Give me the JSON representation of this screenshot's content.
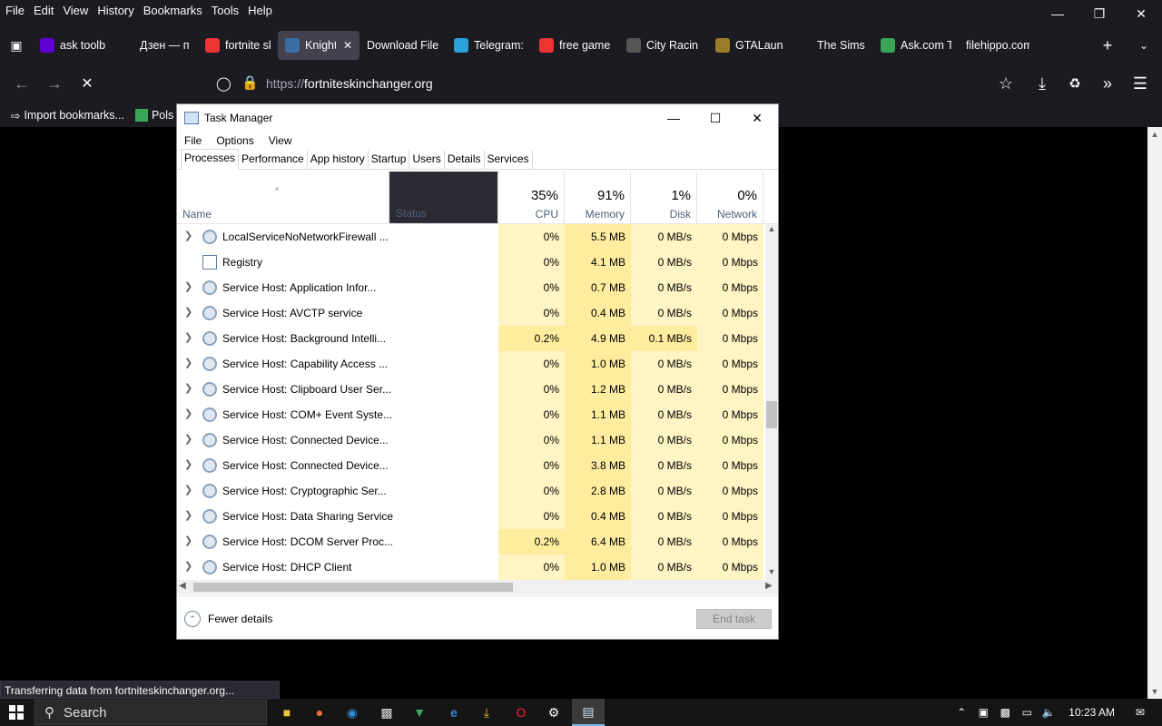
{
  "firefox": {
    "menu": [
      "File",
      "Edit",
      "View",
      "History",
      "Bookmarks",
      "Tools",
      "Help"
    ],
    "tabs": [
      {
        "label": "ask toolba",
        "icon": "yahoo-icon",
        "color": "#6001d2"
      },
      {
        "label": "Дзен — п",
        "icon": "sparkle-icon",
        "color": "#1c1b22"
      },
      {
        "label": "fortnite sk",
        "icon": "yandex-icon",
        "color": "#e33"
      },
      {
        "label": "Knight",
        "icon": "loading-dot-icon",
        "color": "#3a6ea5",
        "active": true
      },
      {
        "label": "Download File",
        "icon": "",
        "color": ""
      },
      {
        "label": "Telegram:",
        "icon": "telegram-icon",
        "color": "#2aa1da"
      },
      {
        "label": "free game",
        "icon": "yandex-icon",
        "color": "#e33"
      },
      {
        "label": "City Racin",
        "icon": "game-icon",
        "color": "#555"
      },
      {
        "label": "GTALaunc",
        "icon": "game-icon",
        "color": "#9a7b2a"
      },
      {
        "label": "The Sims",
        "icon": "plumbob-icon",
        "color": "#1c1b22"
      },
      {
        "label": "Ask.com T",
        "icon": "ask-icon",
        "color": "#3aa655"
      },
      {
        "label": "filehippo.com",
        "icon": "",
        "color": ""
      }
    ],
    "url_proto": "https://",
    "url_host": "fortniteskinchanger.org",
    "bookmarks": [
      {
        "label": "Import bookmarks..."
      },
      {
        "label": "Pols"
      }
    ],
    "status": "Transferring data from fortniteskinchanger.org..."
  },
  "taskmgr": {
    "title": "Task Manager",
    "menu": [
      "File",
      "Options",
      "View"
    ],
    "tabs": [
      "Processes",
      "Performance",
      "App history",
      "Startup",
      "Users",
      "Details",
      "Services"
    ],
    "columns": {
      "name": "Name",
      "status": "Status",
      "cpu_pct": "35%",
      "cpu": "CPU",
      "mem_pct": "91%",
      "mem": "Memory",
      "disk_pct": "1%",
      "disk": "Disk",
      "net_pct": "0%",
      "net": "Network"
    },
    "rows": [
      {
        "name": "LocalServiceNoNetworkFirewall ...",
        "cpu": "0%",
        "mem": "5.5 MB",
        "disk": "0 MB/s",
        "net": "0 Mbps",
        "exp": true
      },
      {
        "name": "Registry",
        "cpu": "0%",
        "mem": "4.1 MB",
        "disk": "0 MB/s",
        "net": "0 Mbps",
        "exp": false
      },
      {
        "name": "Service Host: Application Infor...",
        "cpu": "0%",
        "mem": "0.7 MB",
        "disk": "0 MB/s",
        "net": "0 Mbps",
        "exp": true
      },
      {
        "name": "Service Host: AVCTP service",
        "cpu": "0%",
        "mem": "0.4 MB",
        "disk": "0 MB/s",
        "net": "0 Mbps",
        "exp": true
      },
      {
        "name": "Service Host: Background Intelli...",
        "cpu": "0.2%",
        "mem": "4.9 MB",
        "disk": "0.1 MB/s",
        "net": "0 Mbps",
        "exp": true
      },
      {
        "name": "Service Host: Capability Access ...",
        "cpu": "0%",
        "mem": "1.0 MB",
        "disk": "0 MB/s",
        "net": "0 Mbps",
        "exp": true
      },
      {
        "name": "Service Host: Clipboard User Ser...",
        "cpu": "0%",
        "mem": "1.2 MB",
        "disk": "0 MB/s",
        "net": "0 Mbps",
        "exp": true
      },
      {
        "name": "Service Host: COM+ Event Syste...",
        "cpu": "0%",
        "mem": "1.1 MB",
        "disk": "0 MB/s",
        "net": "0 Mbps",
        "exp": true
      },
      {
        "name": "Service Host: Connected Device...",
        "cpu": "0%",
        "mem": "1.1 MB",
        "disk": "0 MB/s",
        "net": "0 Mbps",
        "exp": true
      },
      {
        "name": "Service Host: Connected Device...",
        "cpu": "0%",
        "mem": "3.8 MB",
        "disk": "0 MB/s",
        "net": "0 Mbps",
        "exp": true
      },
      {
        "name": "Service Host: Cryptographic Ser...",
        "cpu": "0%",
        "mem": "2.8 MB",
        "disk": "0 MB/s",
        "net": "0 Mbps",
        "exp": true
      },
      {
        "name": "Service Host: Data Sharing Service",
        "cpu": "0%",
        "mem": "0.4 MB",
        "disk": "0 MB/s",
        "net": "0 Mbps",
        "exp": true
      },
      {
        "name": "Service Host: DCOM Server Proc...",
        "cpu": "0.2%",
        "mem": "6.4 MB",
        "disk": "0 MB/s",
        "net": "0 Mbps",
        "exp": true
      },
      {
        "name": "Service Host: DHCP Client",
        "cpu": "0%",
        "mem": "1.0 MB",
        "disk": "0 MB/s",
        "net": "0 Mbps",
        "exp": true
      }
    ],
    "fewer_details": "Fewer details",
    "end_task": "End task"
  },
  "taskbar": {
    "search_placeholder": "Search",
    "clock": "10:23 AM"
  }
}
